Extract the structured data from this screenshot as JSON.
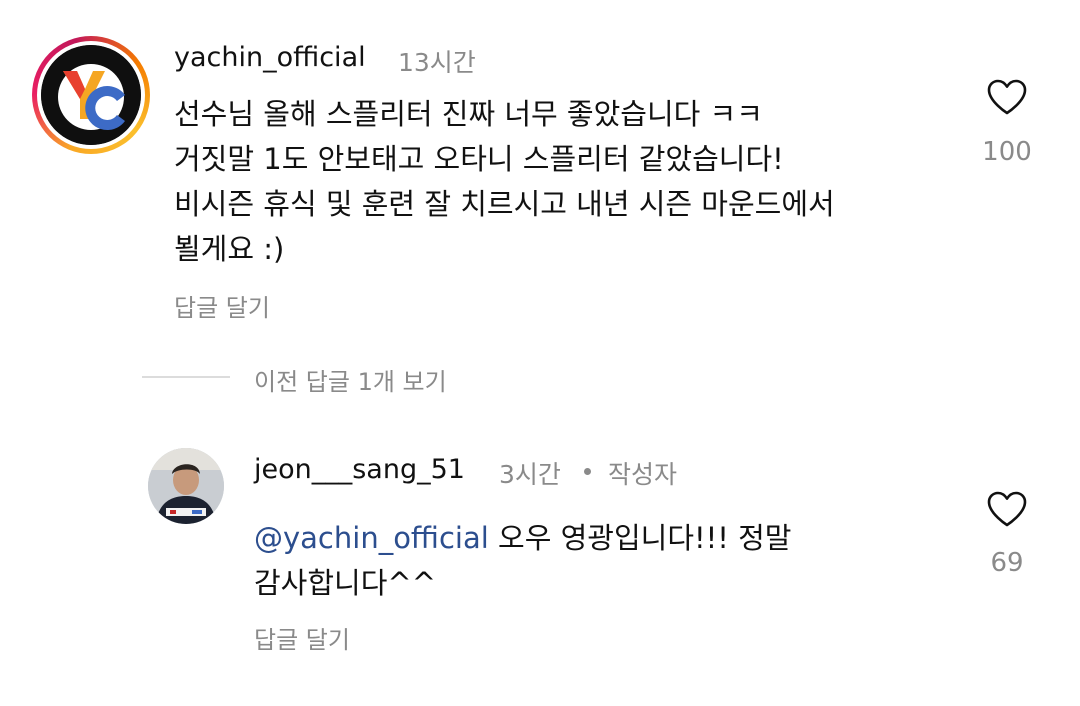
{
  "comment": {
    "username": "yachin_official",
    "time": "13시간",
    "lines": [
      "선수님 올해 스플리터 진짜 너무 좋았습니다 ㅋㅋ",
      "거짓말 1도 안보태고 오타니 스플리터 같았습니다!",
      "비시즌 휴식 및 훈련 잘 치르시고 내년 시즌 마운드에서",
      "뵐게요 :)"
    ],
    "reply_label": "답글 달기",
    "like_count": "100",
    "avatar_logo_text": "YC",
    "icons": {
      "like": "heart-outline-icon"
    }
  },
  "thread": {
    "view_previous_label": "이전 답글 1개 보기"
  },
  "reply": {
    "username": "jeon___sang_51",
    "time": "3시간",
    "author_badge": "작성자",
    "mention": "@yachin_official",
    "line1_rest": " 오우 영광입니다!!! 정말",
    "line2": "감사합니다^^",
    "reply_label": "답글 달기",
    "like_count": "69",
    "icons": {
      "like": "heart-outline-icon"
    }
  },
  "colors": {
    "text_primary": "#111111",
    "text_secondary": "#8a8a8a",
    "mention": "#2c4e8e",
    "divider": "#dcdcdc"
  }
}
